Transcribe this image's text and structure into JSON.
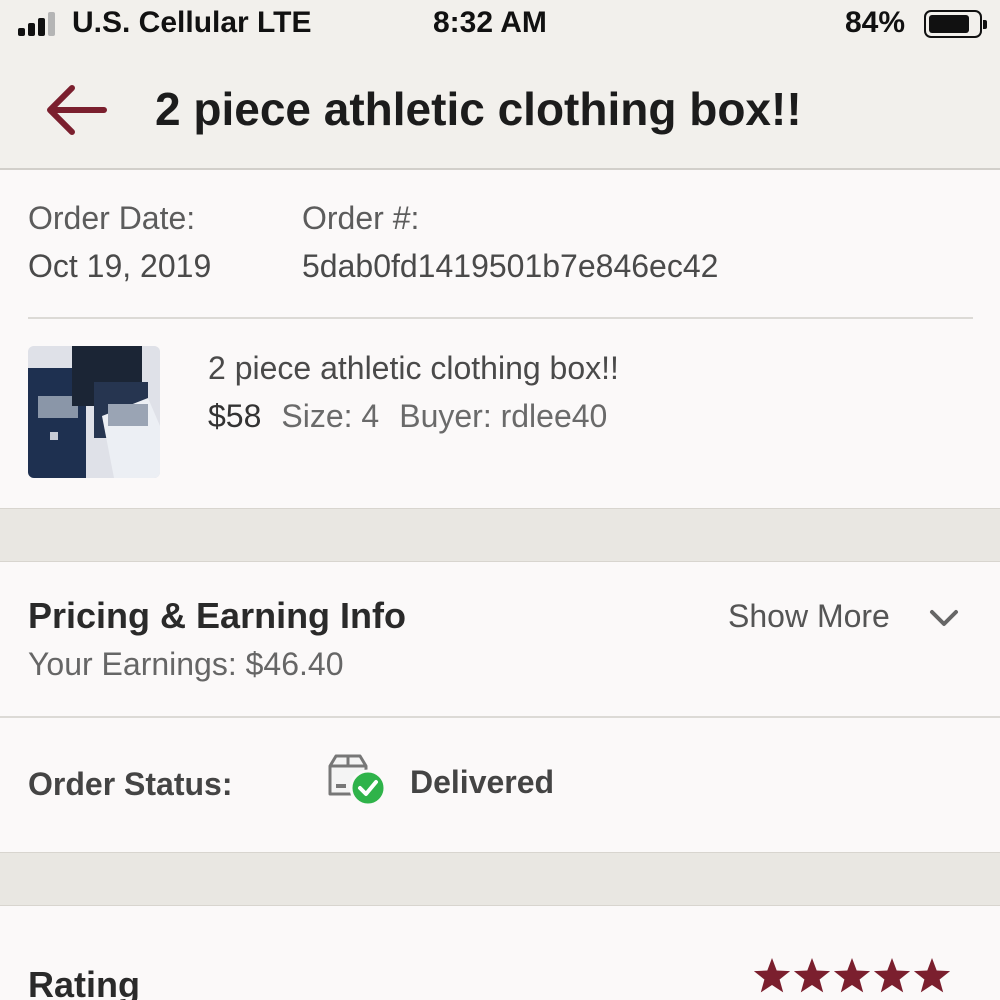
{
  "status_bar": {
    "carrier": "U.S. Cellular LTE",
    "time": "8:32 AM",
    "battery": "84%",
    "battery_level": 0.84,
    "signal_bars": 3
  },
  "header": {
    "back_icon": "arrow-left-icon",
    "title": "2 piece athletic clothing box!!"
  },
  "order": {
    "date_label": "Order Date:",
    "date_value": "Oct 19, 2019",
    "number_label": "Order #:",
    "number_value": "5dab0fd1419501b7e846ec42"
  },
  "item": {
    "title": "2 piece athletic clothing box!!",
    "price": "$58",
    "size": "Size: 4",
    "buyer": "Buyer: rdlee40"
  },
  "pricing": {
    "title": "Pricing & Earning Info",
    "earnings": "Your Earnings: $46.40",
    "show_more": "Show More",
    "chevron_icon": "chevron-down-icon"
  },
  "status": {
    "label": "Order Status:",
    "value": "Delivered",
    "icon": "package-delivered-icon"
  },
  "rating": {
    "label": "Rating",
    "stars": 5
  },
  "colors": {
    "accent": "#7b1f2e",
    "success": "#2fb34a",
    "header_bg": "#f2f0ec",
    "page_bg": "#fbf9f9"
  }
}
